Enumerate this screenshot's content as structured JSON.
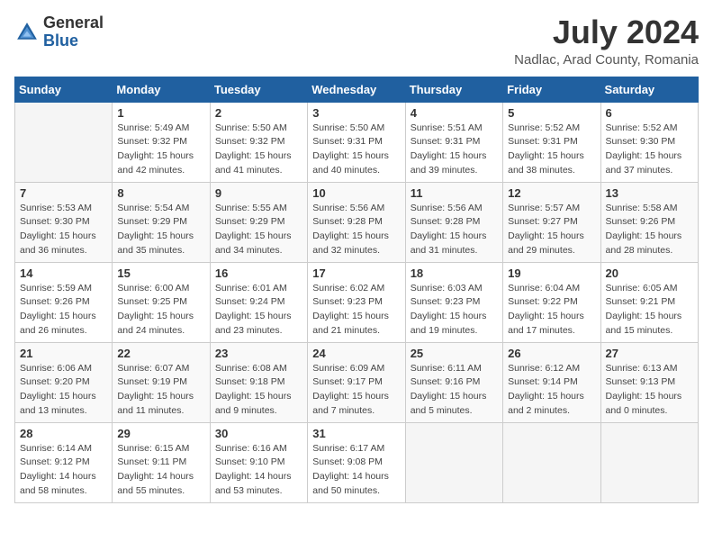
{
  "logo": {
    "general": "General",
    "blue": "Blue"
  },
  "title": "July 2024",
  "location": "Nadlac, Arad County, Romania",
  "days_of_week": [
    "Sunday",
    "Monday",
    "Tuesday",
    "Wednesday",
    "Thursday",
    "Friday",
    "Saturday"
  ],
  "weeks": [
    [
      {
        "day": "",
        "sunrise": "",
        "sunset": "",
        "daylight": ""
      },
      {
        "day": "1",
        "sunrise": "Sunrise: 5:49 AM",
        "sunset": "Sunset: 9:32 PM",
        "daylight": "Daylight: 15 hours and 42 minutes."
      },
      {
        "day": "2",
        "sunrise": "Sunrise: 5:50 AM",
        "sunset": "Sunset: 9:32 PM",
        "daylight": "Daylight: 15 hours and 41 minutes."
      },
      {
        "day": "3",
        "sunrise": "Sunrise: 5:50 AM",
        "sunset": "Sunset: 9:31 PM",
        "daylight": "Daylight: 15 hours and 40 minutes."
      },
      {
        "day": "4",
        "sunrise": "Sunrise: 5:51 AM",
        "sunset": "Sunset: 9:31 PM",
        "daylight": "Daylight: 15 hours and 39 minutes."
      },
      {
        "day": "5",
        "sunrise": "Sunrise: 5:52 AM",
        "sunset": "Sunset: 9:31 PM",
        "daylight": "Daylight: 15 hours and 38 minutes."
      },
      {
        "day": "6",
        "sunrise": "Sunrise: 5:52 AM",
        "sunset": "Sunset: 9:30 PM",
        "daylight": "Daylight: 15 hours and 37 minutes."
      }
    ],
    [
      {
        "day": "7",
        "sunrise": "Sunrise: 5:53 AM",
        "sunset": "Sunset: 9:30 PM",
        "daylight": "Daylight: 15 hours and 36 minutes."
      },
      {
        "day": "8",
        "sunrise": "Sunrise: 5:54 AM",
        "sunset": "Sunset: 9:29 PM",
        "daylight": "Daylight: 15 hours and 35 minutes."
      },
      {
        "day": "9",
        "sunrise": "Sunrise: 5:55 AM",
        "sunset": "Sunset: 9:29 PM",
        "daylight": "Daylight: 15 hours and 34 minutes."
      },
      {
        "day": "10",
        "sunrise": "Sunrise: 5:56 AM",
        "sunset": "Sunset: 9:28 PM",
        "daylight": "Daylight: 15 hours and 32 minutes."
      },
      {
        "day": "11",
        "sunrise": "Sunrise: 5:56 AM",
        "sunset": "Sunset: 9:28 PM",
        "daylight": "Daylight: 15 hours and 31 minutes."
      },
      {
        "day": "12",
        "sunrise": "Sunrise: 5:57 AM",
        "sunset": "Sunset: 9:27 PM",
        "daylight": "Daylight: 15 hours and 29 minutes."
      },
      {
        "day": "13",
        "sunrise": "Sunrise: 5:58 AM",
        "sunset": "Sunset: 9:26 PM",
        "daylight": "Daylight: 15 hours and 28 minutes."
      }
    ],
    [
      {
        "day": "14",
        "sunrise": "Sunrise: 5:59 AM",
        "sunset": "Sunset: 9:26 PM",
        "daylight": "Daylight: 15 hours and 26 minutes."
      },
      {
        "day": "15",
        "sunrise": "Sunrise: 6:00 AM",
        "sunset": "Sunset: 9:25 PM",
        "daylight": "Daylight: 15 hours and 24 minutes."
      },
      {
        "day": "16",
        "sunrise": "Sunrise: 6:01 AM",
        "sunset": "Sunset: 9:24 PM",
        "daylight": "Daylight: 15 hours and 23 minutes."
      },
      {
        "day": "17",
        "sunrise": "Sunrise: 6:02 AM",
        "sunset": "Sunset: 9:23 PM",
        "daylight": "Daylight: 15 hours and 21 minutes."
      },
      {
        "day": "18",
        "sunrise": "Sunrise: 6:03 AM",
        "sunset": "Sunset: 9:23 PM",
        "daylight": "Daylight: 15 hours and 19 minutes."
      },
      {
        "day": "19",
        "sunrise": "Sunrise: 6:04 AM",
        "sunset": "Sunset: 9:22 PM",
        "daylight": "Daylight: 15 hours and 17 minutes."
      },
      {
        "day": "20",
        "sunrise": "Sunrise: 6:05 AM",
        "sunset": "Sunset: 9:21 PM",
        "daylight": "Daylight: 15 hours and 15 minutes."
      }
    ],
    [
      {
        "day": "21",
        "sunrise": "Sunrise: 6:06 AM",
        "sunset": "Sunset: 9:20 PM",
        "daylight": "Daylight: 15 hours and 13 minutes."
      },
      {
        "day": "22",
        "sunrise": "Sunrise: 6:07 AM",
        "sunset": "Sunset: 9:19 PM",
        "daylight": "Daylight: 15 hours and 11 minutes."
      },
      {
        "day": "23",
        "sunrise": "Sunrise: 6:08 AM",
        "sunset": "Sunset: 9:18 PM",
        "daylight": "Daylight: 15 hours and 9 minutes."
      },
      {
        "day": "24",
        "sunrise": "Sunrise: 6:09 AM",
        "sunset": "Sunset: 9:17 PM",
        "daylight": "Daylight: 15 hours and 7 minutes."
      },
      {
        "day": "25",
        "sunrise": "Sunrise: 6:11 AM",
        "sunset": "Sunset: 9:16 PM",
        "daylight": "Daylight: 15 hours and 5 minutes."
      },
      {
        "day": "26",
        "sunrise": "Sunrise: 6:12 AM",
        "sunset": "Sunset: 9:14 PM",
        "daylight": "Daylight: 15 hours and 2 minutes."
      },
      {
        "day": "27",
        "sunrise": "Sunrise: 6:13 AM",
        "sunset": "Sunset: 9:13 PM",
        "daylight": "Daylight: 15 hours and 0 minutes."
      }
    ],
    [
      {
        "day": "28",
        "sunrise": "Sunrise: 6:14 AM",
        "sunset": "Sunset: 9:12 PM",
        "daylight": "Daylight: 14 hours and 58 minutes."
      },
      {
        "day": "29",
        "sunrise": "Sunrise: 6:15 AM",
        "sunset": "Sunset: 9:11 PM",
        "daylight": "Daylight: 14 hours and 55 minutes."
      },
      {
        "day": "30",
        "sunrise": "Sunrise: 6:16 AM",
        "sunset": "Sunset: 9:10 PM",
        "daylight": "Daylight: 14 hours and 53 minutes."
      },
      {
        "day": "31",
        "sunrise": "Sunrise: 6:17 AM",
        "sunset": "Sunset: 9:08 PM",
        "daylight": "Daylight: 14 hours and 50 minutes."
      },
      {
        "day": "",
        "sunrise": "",
        "sunset": "",
        "daylight": ""
      },
      {
        "day": "",
        "sunrise": "",
        "sunset": "",
        "daylight": ""
      },
      {
        "day": "",
        "sunrise": "",
        "sunset": "",
        "daylight": ""
      }
    ]
  ]
}
